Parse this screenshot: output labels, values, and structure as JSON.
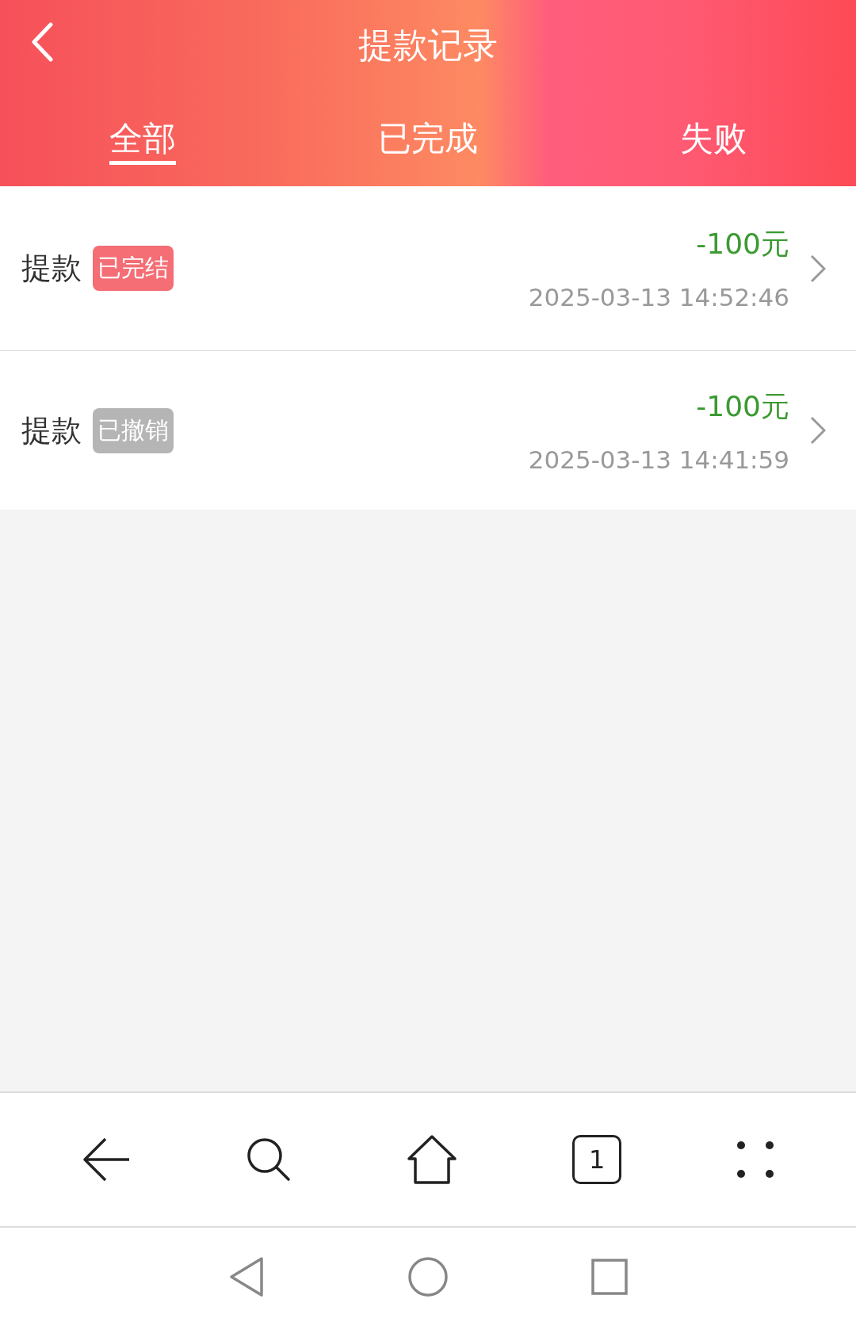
{
  "header": {
    "title": "提款记录"
  },
  "tabs": [
    {
      "label": "全部",
      "selected": true
    },
    {
      "label": "已完成",
      "selected": false
    },
    {
      "label": "失败",
      "selected": false
    }
  ],
  "records": [
    {
      "label": "提款",
      "status": "已完结",
      "color": "#f56d75",
      "amount": "-100元",
      "time": "2025-03-13 14:52:46"
    },
    {
      "label": "提款",
      "status": "已撤销",
      "color": "#b5b5b5",
      "amount": "-100元",
      "time": "2025-03-13 14:41:59"
    }
  ],
  "browser_bar": {
    "tab_count": "1"
  }
}
